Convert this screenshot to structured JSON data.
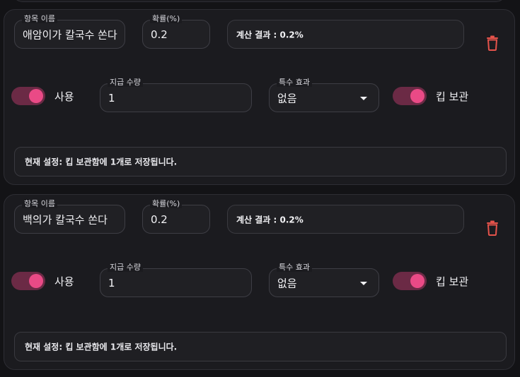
{
  "colors": {
    "accent": "#ea4a86",
    "accent_track": "#6b2a45",
    "delete": "#e5534b"
  },
  "icons": [
    "trash-icon",
    "chevron-down-icon"
  ],
  "items": [
    {
      "name_label": "항목 이름",
      "name_value": "애암이가 칼국수 쏜다",
      "rate_label": "확률(%)",
      "rate_value": "0.2",
      "result_text": "계산 결과 : 0.2%",
      "use_label": "사용",
      "use_on": true,
      "qty_label": "지급 수량",
      "qty_value": "1",
      "effect_label": "특수 효과",
      "effect_value": "없음",
      "keep_label": "킵 보관",
      "keep_on": true,
      "status_text": "현재 설정: 킵 보관함에 1개로 저장됩니다."
    },
    {
      "name_label": "항목 이름",
      "name_value": "백의가 칼국수 쏜다",
      "rate_label": "확률(%)",
      "rate_value": "0.2",
      "result_text": "계산 결과 : 0.2%",
      "use_label": "사용",
      "use_on": true,
      "qty_label": "지급 수량",
      "qty_value": "1",
      "effect_label": "특수 효과",
      "effect_value": "없음",
      "keep_label": "킵 보관",
      "keep_on": true,
      "status_text": "현재 설정: 킵 보관함에 1개로 저장됩니다."
    }
  ]
}
